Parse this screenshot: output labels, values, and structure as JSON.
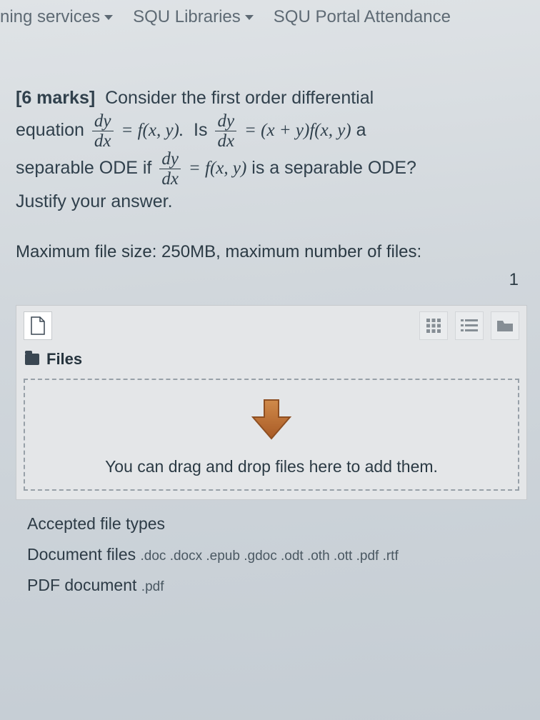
{
  "topbar": {
    "item0": "ning services",
    "item1": "SQU Libraries",
    "item2": "SQU Portal Attendance"
  },
  "question": {
    "marks": "[6 marks]",
    "t1": "Consider the first order differential",
    "t2": "equation",
    "eq1a": "dy",
    "eq1b": "dx",
    "eq1c": "= f(x, y).",
    "t3": "Is",
    "eq2a": "dy",
    "eq2b": "dx",
    "eq2c": "= (x + y)f(x, y)",
    "t4": "a",
    "t5": "separable ODE if",
    "eq3a": "dy",
    "eq3b": "dx",
    "eq3c": "= f(x, y)",
    "t6": "is a separable ODE?",
    "t7": "Justify your answer."
  },
  "limits": {
    "line": "Maximum file size: 250MB, maximum number of files:",
    "max": "1"
  },
  "panel": {
    "section": "Files",
    "drop": "You can drag and drop files here to add them."
  },
  "accepted": {
    "hdr": "Accepted file types",
    "doc_label": "Document files",
    "doc_exts": ".doc .docx .epub .gdoc .odt .oth .ott .pdf .rtf",
    "pdf_label": "PDF document",
    "pdf_exts": ".pdf"
  }
}
